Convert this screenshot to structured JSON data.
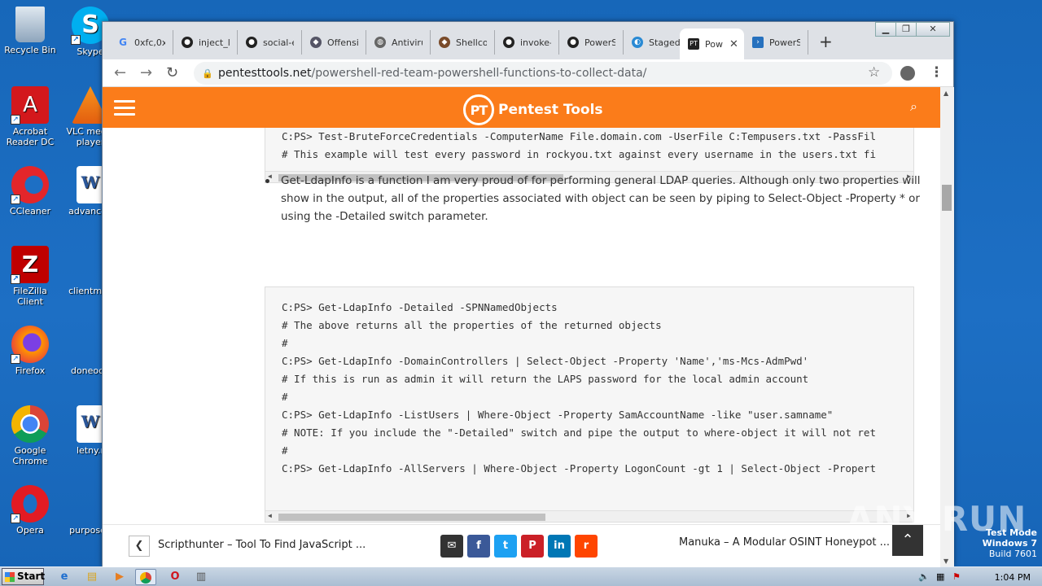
{
  "desktop": {
    "icons": [
      {
        "label": "Recycle Bin",
        "icon": "recycle-bin-icon"
      },
      {
        "label": "Skype",
        "icon": "skype-icon"
      },
      {
        "label": "Acrobat Reader DC",
        "icon": "acrobat-icon"
      },
      {
        "label": "VLC media player",
        "icon": "vlc-icon"
      },
      {
        "label": "CCleaner",
        "icon": "ccleaner-icon"
      },
      {
        "label": "advanced",
        "icon": "word-doc-icon"
      },
      {
        "label": "FileZilla Client",
        "icon": "filezilla-icon"
      },
      {
        "label": "clientmail",
        "icon": "blank-file-icon"
      },
      {
        "label": "Firefox",
        "icon": "firefox-icon"
      },
      {
        "label": "doneoct.",
        "icon": "blank-file-icon"
      },
      {
        "label": "Google Chrome",
        "icon": "chrome-icon"
      },
      {
        "label": "letny.r",
        "icon": "word-doc-icon"
      },
      {
        "label": "Opera",
        "icon": "opera-icon"
      },
      {
        "label": "purposed",
        "icon": "blank-file-icon"
      }
    ]
  },
  "browser": {
    "tabs": [
      {
        "title": "0xfc,0x",
        "icon": "google-icon"
      },
      {
        "title": "inject_l",
        "icon": "github-icon"
      },
      {
        "title": "social-e",
        "icon": "github-icon"
      },
      {
        "title": "Offensi",
        "icon": "site-icon"
      },
      {
        "title": "Antiviru",
        "icon": "globe-icon"
      },
      {
        "title": "Shellcod",
        "icon": "site-icon"
      },
      {
        "title": "invoke-",
        "icon": "github-icon"
      },
      {
        "title": "PowerS",
        "icon": "github-icon"
      },
      {
        "title": "Staged",
        "icon": "site-icon"
      },
      {
        "title": "Pow",
        "icon": "pentesttools-icon"
      },
      {
        "title": "PowerS",
        "icon": "powershell-icon"
      }
    ],
    "active_tab_index": 9,
    "url_domain": "pentesttools.net",
    "url_path": "/powershell-red-team-powershell-functions-to-collect-data/"
  },
  "site": {
    "logo_initials": "PT",
    "logo_text": "Pentest Tools"
  },
  "article": {
    "code1_lines": [
      "C:PS> Test-BruteForceCredentials -ComputerName File.domain.com -UserFile C:Tempusers.txt -PassFil",
      "# This example will test every password in rockyou.txt against every username in the users.txt fi"
    ],
    "bullet_text": "Get-LdapInfo is a function I am very proud of for performing general LDAP queries. Although only two properties will show in the output, all of the properties associated with object can be seen by piping to Select-Object -Property * or using the -Detailed switch parameter.",
    "code2_lines": [
      "C:PS> Get-LdapInfo -Detailed -SPNNamedObjects",
      "# The above returns all the properties of the returned objects",
      "#",
      "C:PS> Get-LdapInfo -DomainControllers | Select-Object -Property 'Name','ms-Mcs-AdmPwd'",
      "# If this is run as admin it will return the LAPS password for the local admin account",
      "#",
      "C:PS> Get-LdapInfo -ListUsers | Where-Object -Property SamAccountName -like \"user.samname\"",
      "# NOTE: If you include the \"-Detailed\" switch and pipe the output to where-object it will not ret",
      "#",
      "C:PS> Get-LdapInfo -AllServers | Where-Object -Property LogonCount -gt 1 | Select-Object -Propert"
    ]
  },
  "post_nav": {
    "prev_title": "Scripthunter – Tool To Find JavaScript ...",
    "next_title": "Manuka – A Modular OSINT Honeypot ...",
    "share": [
      {
        "name": "email",
        "color": "#333333",
        "glyph": "✉"
      },
      {
        "name": "facebook",
        "color": "#3b5998",
        "glyph": "f"
      },
      {
        "name": "twitter",
        "color": "#1da1f2",
        "glyph": "t"
      },
      {
        "name": "pinterest",
        "color": "#cb2027",
        "glyph": "P"
      },
      {
        "name": "linkedin",
        "color": "#0077b5",
        "glyph": "in"
      },
      {
        "name": "reddit",
        "color": "#ff4500",
        "glyph": "r"
      }
    ]
  },
  "watermark": "ANY RUN",
  "os": {
    "test_mode_line1": "Test Mode",
    "test_mode_line2": "Windows 7",
    "test_mode_line3": "Build 7601",
    "start_label": "Start",
    "clock": "1:04 PM"
  }
}
